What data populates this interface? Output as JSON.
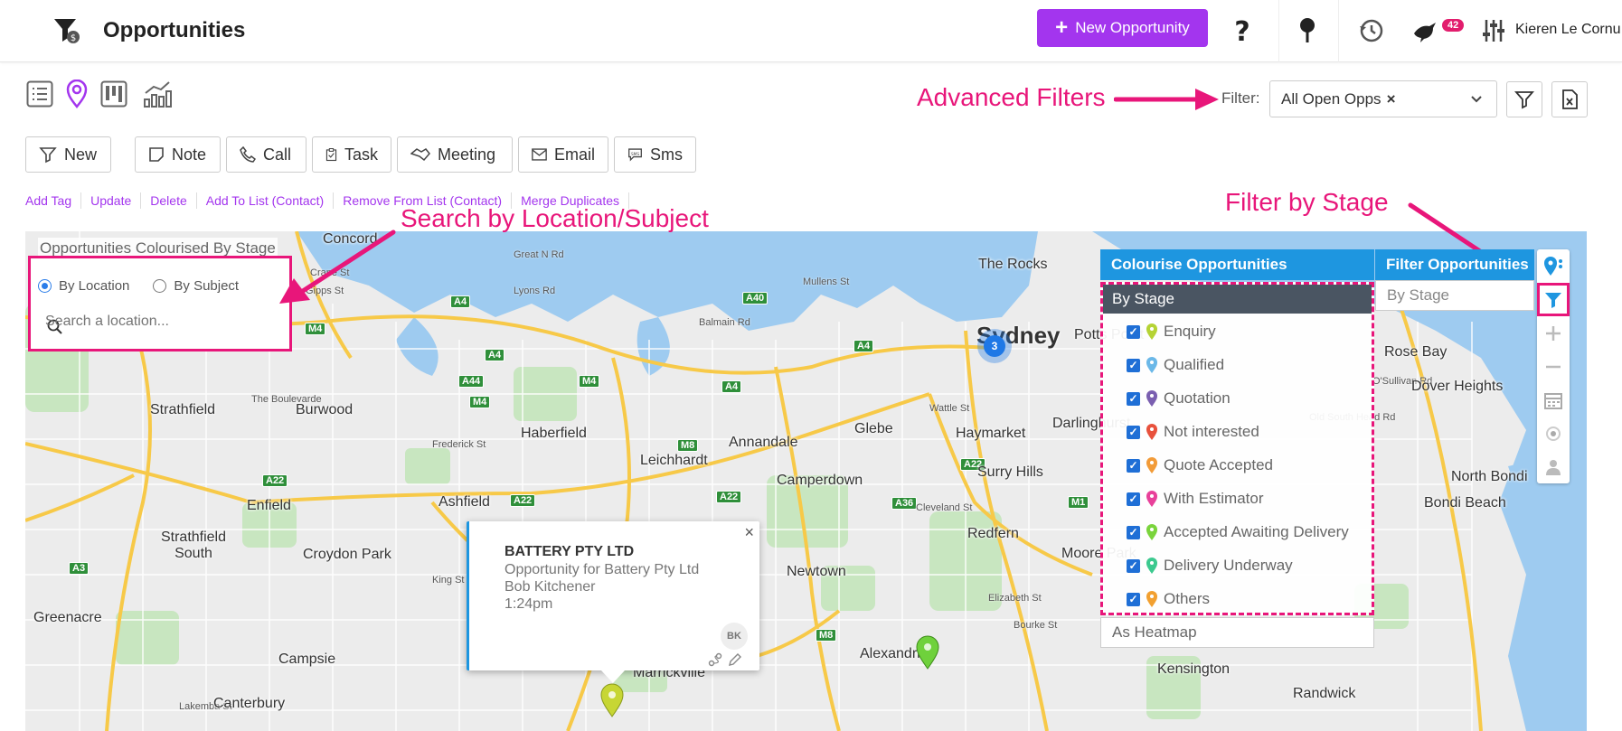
{
  "header": {
    "title": "Opportunities",
    "new_button": "New Opportunity",
    "notification_count": "42",
    "user_name": "Kieren Le Cornu"
  },
  "annotations": {
    "advanced_filters": "Advanced Filters",
    "search_by": "Search by Location/Subject",
    "filter_by_stage": "Filter by Stage"
  },
  "filter": {
    "label": "Filter:",
    "value": "All Open Opps",
    "clear": "×"
  },
  "actions": [
    "New",
    "Note",
    "Call",
    "Task",
    "Meeting",
    "Email",
    "Sms"
  ],
  "links": [
    "Add Tag",
    "Update",
    "Delete",
    "Add To List (Contact)",
    "Remove From List (Contact)",
    "Merge Duplicates"
  ],
  "map": {
    "title": "Opportunities Colourised By Stage",
    "search": {
      "option_location": "By Location",
      "option_subject": "By Subject",
      "placeholder": "Search a location..."
    },
    "cluster_count": "3",
    "places": [
      "Concord",
      "The Rocks",
      "Sydney",
      "Potts Point",
      "Rose Bay",
      "Dover Heights",
      "Strathfield",
      "Burwood",
      "Haberfield",
      "Leichhardt",
      "Annandale",
      "Glebe",
      "Haymarket",
      "Darlinghurst",
      "North Bondi",
      "Bondi Beach",
      "Camperdown",
      "Surry Hills",
      "Enfield",
      "Ashfield",
      "Strathfield South",
      "Croydon Park",
      "Redfern",
      "Moore Park",
      "Newtown",
      "Greenacre",
      "Campsie",
      "Alexandria",
      "Marrickville",
      "Kensington",
      "Canterbury",
      "Randwick"
    ]
  },
  "colourise": {
    "title": "Colourise Opportunities",
    "by_stage": "By Stage",
    "stages": [
      {
        "label": "Enquiry",
        "color": "#b5d334"
      },
      {
        "label": "Qualified",
        "color": "#6bb8e8"
      },
      {
        "label": "Quotation",
        "color": "#7a5fb0"
      },
      {
        "label": "Not interested",
        "color": "#e8513c"
      },
      {
        "label": "Quote Accepted",
        "color": "#f29b38"
      },
      {
        "label": "With Estimator",
        "color": "#e8409a"
      },
      {
        "label": "Accepted Awaiting Delivery",
        "color": "#7ad43c"
      },
      {
        "label": "Delivery Underway",
        "color": "#3cc98f"
      },
      {
        "label": "Others",
        "color": "#f2a030"
      }
    ],
    "heatmap": "As Heatmap"
  },
  "filter_opps": {
    "title": "Filter Opportunities",
    "by_stage": "By Stage"
  },
  "popup": {
    "title": "BATTERY PTY LTD",
    "line1": "Opportunity for Battery Pty Ltd",
    "line2": "Bob Kitchener",
    "line3": "1:24pm",
    "avatar": "BK",
    "close": "×"
  }
}
